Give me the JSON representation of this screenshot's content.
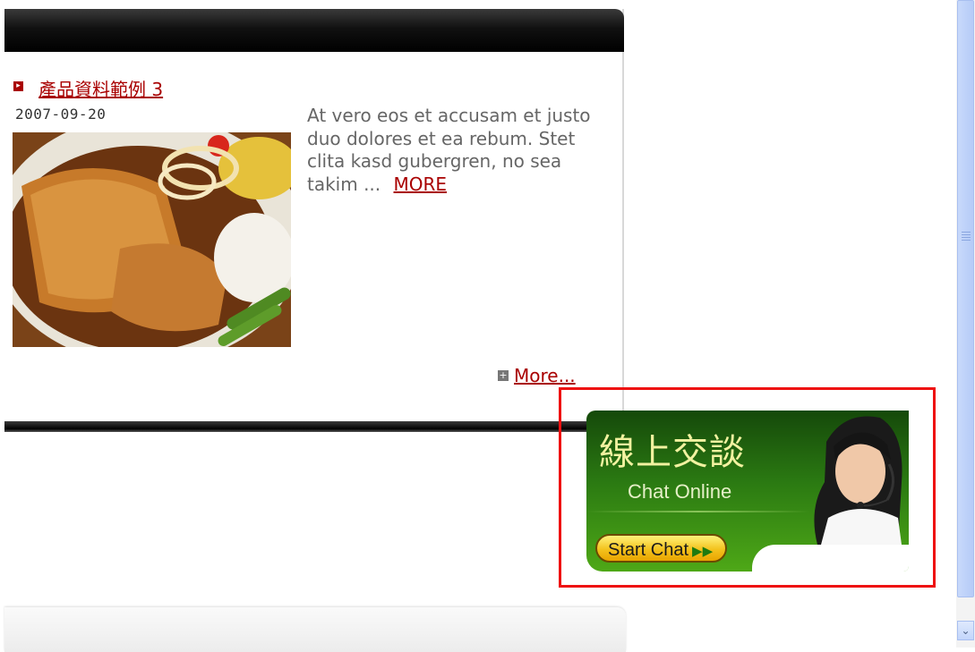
{
  "product": {
    "title": "產品資料範例 3",
    "date": "2007-09-20",
    "description": "At vero eos et accusam et justo duo dolores et ea rebum. Stet clita kasd gubergren, no sea takim ...",
    "more_short": "MORE",
    "more_link": "More..."
  },
  "chat_banner": {
    "title": "線上交談",
    "subtitle": "Chat Online",
    "button_label": "Start Chat",
    "button_arrows": "▶▶"
  },
  "icons": {
    "bullet": "arrow-box-icon",
    "more": "plus-box-icon",
    "scroll_down": "chevron-down-icon"
  },
  "colors": {
    "link": "#a90000",
    "highlight_border": "#ee1111",
    "banner_green": "#2b7a12",
    "button_yellow": "#f3c21d"
  }
}
